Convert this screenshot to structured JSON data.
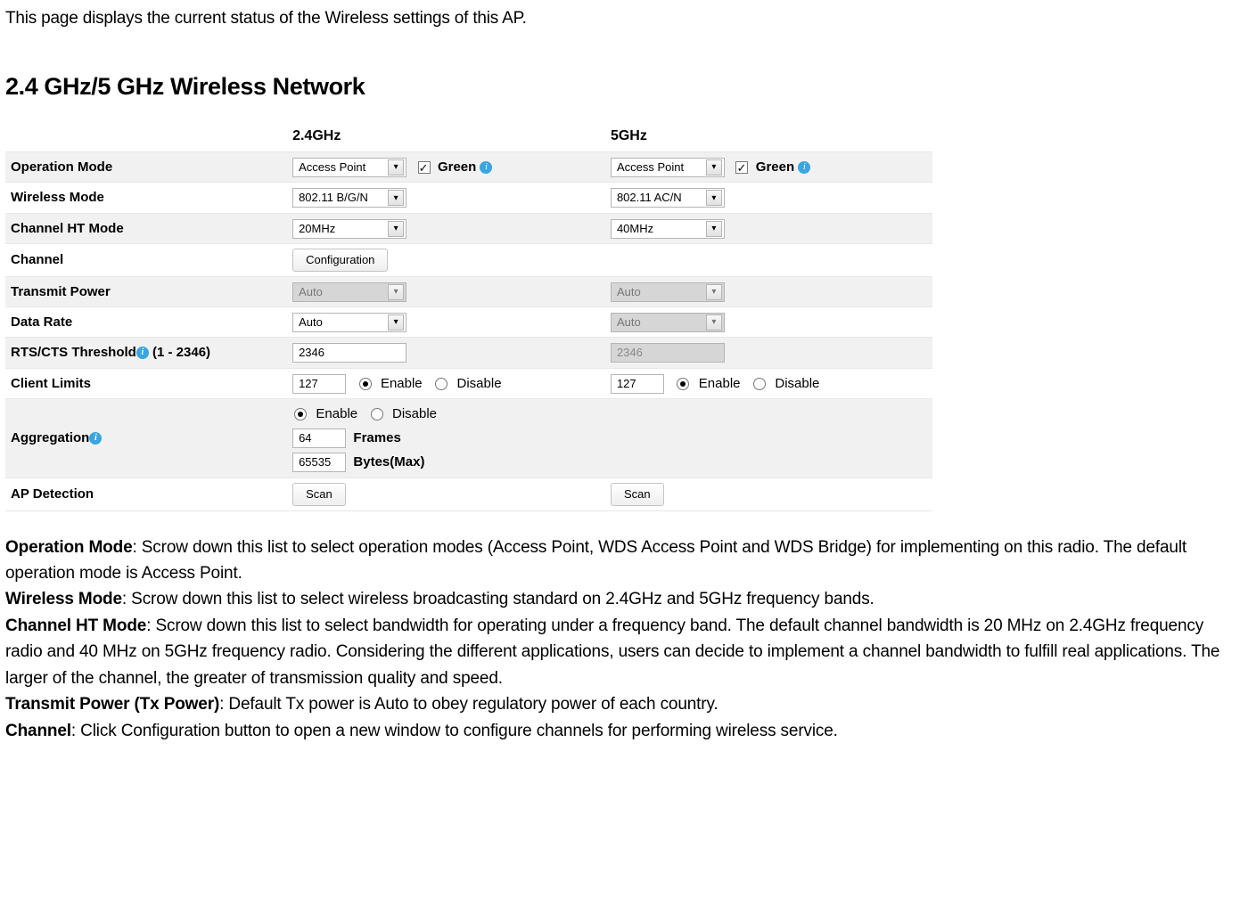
{
  "intro": "This page displays the current status of the Wireless settings of this AP.",
  "sectionHeading": "2.4 GHz/5 GHz Wireless Network",
  "columns": {
    "left": "2.4GHz",
    "right": "5GHz"
  },
  "rows": {
    "operationMode": {
      "label": "Operation Mode",
      "val24": "Access Point",
      "val5": "Access Point",
      "greenLabel": "Green"
    },
    "wirelessMode": {
      "label": "Wireless Mode",
      "val24": "802.11 B/G/N",
      "val5": "802.11 AC/N"
    },
    "channelHT": {
      "label": "Channel HT Mode",
      "val24": "20MHz",
      "val5": "40MHz"
    },
    "channel": {
      "label": "Channel",
      "btn": "Configuration"
    },
    "txPower": {
      "label": "Transmit Power",
      "val24": "Auto",
      "val5": "Auto"
    },
    "dataRate": {
      "label": "Data Rate",
      "val24": "Auto",
      "val5": "Auto"
    },
    "rtscts": {
      "labelPrefix": "RTS/CTS Threshold",
      "labelSuffix": " (1 - 2346)",
      "val24": "2346",
      "val5": "2346"
    },
    "clientLimits": {
      "label": "Client Limits",
      "val24": "127",
      "val5": "127",
      "enable": "Enable",
      "disable": "Disable"
    },
    "aggregation": {
      "label": "Aggregation",
      "enable": "Enable",
      "disable": "Disable",
      "frames": "64",
      "framesLabel": "Frames",
      "bytes": "65535",
      "bytesLabel": "Bytes(Max)"
    },
    "apDetection": {
      "label": "AP Detection",
      "btn": "Scan"
    }
  },
  "defs": {
    "operationMode": {
      "term": "Operation Mode",
      "text": ": Scrow down this list to select operation modes (Access Point, WDS Access Point and WDS Bridge) for implementing on this radio. The default operation mode is Access Point."
    },
    "wirelessMode": {
      "term": "Wireless Mode",
      "text": ": Scrow down this list to select wireless broadcasting standard on 2.4GHz and 5GHz frequency bands."
    },
    "channelHT": {
      "term": "Channel HT Mode",
      "text": ": Scrow down this list to select bandwidth for operating under a frequency band. The default channel bandwidth is 20 MHz on 2.4GHz frequency radio and 40 MHz on 5GHz frequency radio. Considering the different applications, users can decide to implement a channel bandwidth to fulfill real applications. The larger of the channel, the greater of transmission quality and speed."
    },
    "txPower": {
      "term": "Transmit Power (Tx Power)",
      "text": ": Default Tx power is Auto to obey regulatory power of each country."
    },
    "channel": {
      "term": "Channel",
      "text": ": Click Configuration button to open a new window to configure channels for performing wireless service."
    }
  }
}
